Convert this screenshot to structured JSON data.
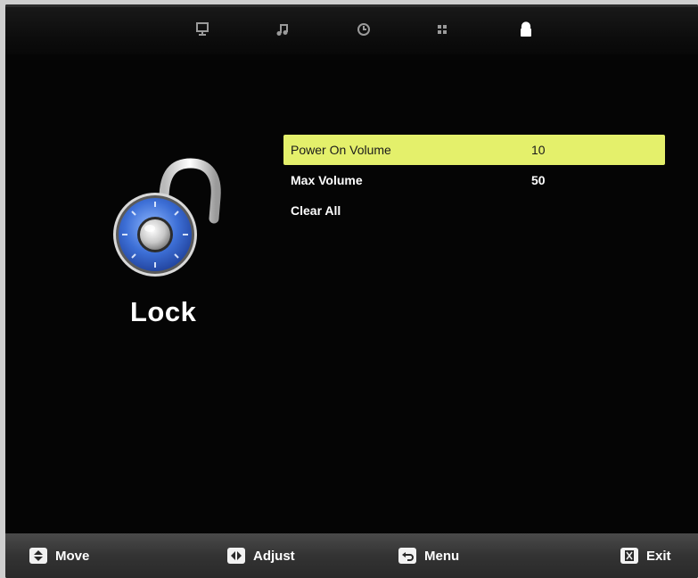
{
  "tabs": [
    {
      "name": "monitor-icon",
      "active": false
    },
    {
      "name": "music-note-icon",
      "active": false
    },
    {
      "name": "clock-icon",
      "active": false
    },
    {
      "name": "grid-icon",
      "active": false
    },
    {
      "name": "lock-icon",
      "active": true
    }
  ],
  "section": {
    "title": "Lock",
    "icon": "combination-padlock-icon"
  },
  "menu": {
    "items": [
      {
        "label": "Power On Volume",
        "value": "10",
        "selected": true
      },
      {
        "label": "Max Volume",
        "value": "50",
        "selected": false
      },
      {
        "label": "Clear All",
        "value": "",
        "selected": false
      }
    ],
    "highlight_color": "#e4f06b"
  },
  "hints": {
    "move": "Move",
    "adjust": "Adjust",
    "menu": "Menu",
    "exit": "Exit"
  }
}
